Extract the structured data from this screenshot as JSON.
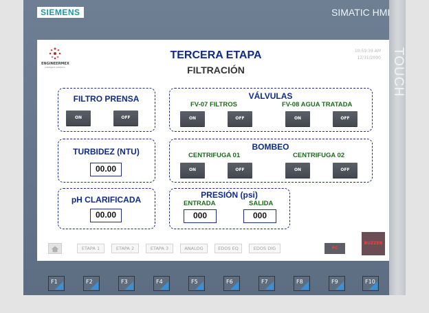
{
  "device": {
    "logo": "SIEMENS",
    "brand": "SIMATIC HMI",
    "side_label": "TOUCH",
    "fkeys": [
      "F1",
      "F2",
      "F3",
      "F4",
      "F5",
      "F6",
      "F7",
      "F8",
      "F9",
      "F10"
    ]
  },
  "screen": {
    "company": "ENGINEERMEX",
    "company_sub": "intelligent solutions",
    "title": "TERCERA ETAPA",
    "subtitle": "FILTRACIÓN",
    "time": "10:59:39 AM",
    "date": "12/31/2000"
  },
  "panels": {
    "filtro_prensa": {
      "title": "FILTRO PRENSA",
      "on": "ON",
      "off": "OFF"
    },
    "valvulas": {
      "title": "VÁLVULAS",
      "fv07": {
        "label": "FV-07 FILTROS",
        "on": "ON",
        "off": "OFF"
      },
      "fv08": {
        "label": "FV-08 AGUA TRATADA",
        "on": "ON",
        "off": "OFF"
      }
    },
    "turbidez": {
      "title": "TURBIDEZ (NTU)",
      "value": "00.00"
    },
    "bombeo": {
      "title": "BOMBEO",
      "c01": {
        "label": "CENTRIFUGA 01",
        "on": "ON",
        "off": "OFF"
      },
      "c02": {
        "label": "CENTRIFUGA 02",
        "on": "ON",
        "off": "OFF"
      }
    },
    "ph": {
      "title": "pH CLARIFICADA",
      "value": "00.00"
    },
    "presion": {
      "title": "PRESIÓN (psi)",
      "entrada_label": "ENTRADA",
      "entrada_value": "000",
      "salida_label": "SALIDA",
      "salida_value": "000"
    }
  },
  "nav": {
    "items": [
      "ETAPA 1",
      "ETAPA 2",
      "ETAPA 3",
      "ANALOG",
      "EDOS EQ",
      "EDOS DIG"
    ],
    "pc": "PC",
    "buzzer": "BUZZER"
  },
  "colors": {
    "title": "#0d2a8a",
    "sub_label": "#1a6b1a",
    "button": "#4f535c",
    "alarm_text": "#ff3b3b",
    "bezel": "#647489"
  }
}
